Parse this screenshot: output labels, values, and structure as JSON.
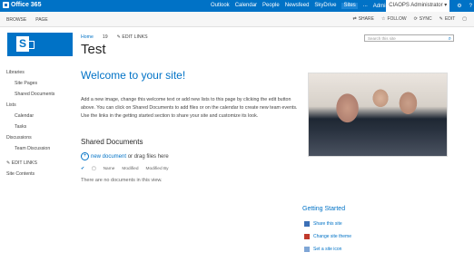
{
  "suite": {
    "brand": "Office 365",
    "links": [
      "Outlook",
      "Calendar",
      "People",
      "Newsfeed",
      "SkyDrive",
      "Sites",
      "...",
      "Admin ▾"
    ],
    "active_link": "Sites",
    "user": "CIAOPS Administrator ▾",
    "gear": "⚙",
    "help": "?"
  },
  "ribbon": {
    "tabs": [
      "BROWSE",
      "PAGE"
    ],
    "actions": [
      {
        "icon": "share-icon",
        "glyph": "⇄",
        "label": "SHARE"
      },
      {
        "icon": "follow-icon",
        "glyph": "☆",
        "label": "FOLLOW"
      },
      {
        "icon": "sync-icon",
        "glyph": "⟳",
        "label": "SYNC"
      },
      {
        "icon": "edit-icon",
        "glyph": "✎",
        "label": "EDIT"
      },
      {
        "icon": "focus-icon",
        "glyph": "▢",
        "label": ""
      }
    ]
  },
  "topnav": {
    "home": "Home",
    "item": "19",
    "edit_links": "✎ EDIT LINKS"
  },
  "search": {
    "placeholder": "Search this site",
    "icon": "⌕"
  },
  "page_title": "Test",
  "leftnav": [
    {
      "label": "Libraries",
      "sub": false
    },
    {
      "label": "Site Pages",
      "sub": true
    },
    {
      "label": "Shared Documents",
      "sub": true
    },
    {
      "label": "Lists",
      "sub": false
    },
    {
      "label": "Calendar",
      "sub": true
    },
    {
      "label": "Tasks",
      "sub": true
    },
    {
      "label": "Discussions",
      "sub": false
    },
    {
      "label": "Team Discussion",
      "sub": true
    },
    {
      "label": "",
      "sub": false
    },
    {
      "label": "✎ EDIT LINKS",
      "sub": false
    },
    {
      "label": "Site Contents",
      "sub": false
    }
  ],
  "welcome": {
    "heading": "Welcome to your site!",
    "body": "Add a new image, change this welcome text or add new lists to this page by clicking the edit button above. You can click on Shared Documents to add files or on the calendar to create new team events. Use the links in the getting started section to share your site and customize its look."
  },
  "documents": {
    "heading": "Shared Documents",
    "new_link": "new document",
    "new_suffix": " or drag files here",
    "columns": [
      "✔",
      "Name",
      "Modified",
      "Modified By"
    ],
    "empty": "There are no documents in this view."
  },
  "getting_started": {
    "heading": "Getting Started",
    "items": [
      {
        "label": "Share this site",
        "color": "#3b6fb6"
      },
      {
        "label": "Change site theme",
        "color": "#c0392b"
      },
      {
        "label": "Set a site icon",
        "color": "#7fa6d6"
      }
    ]
  }
}
